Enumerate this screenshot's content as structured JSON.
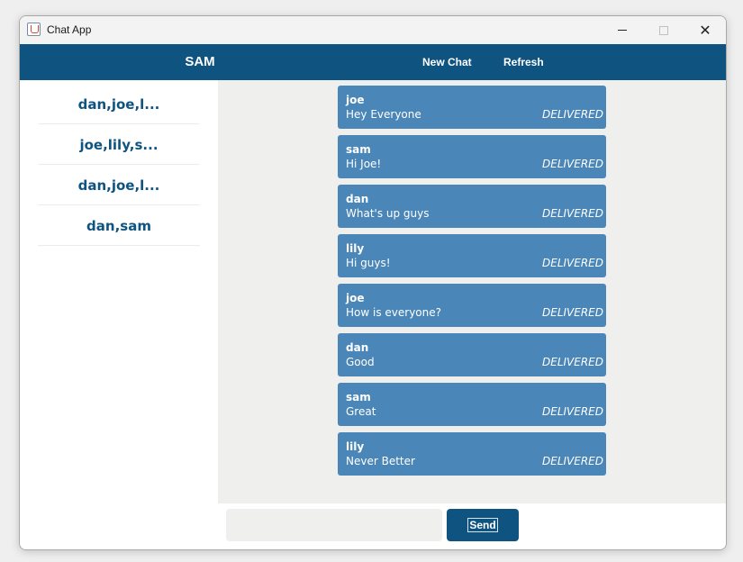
{
  "window": {
    "title": "Chat App",
    "icon": "java-cup-icon"
  },
  "header": {
    "user_name": "SAM",
    "new_chat_label": "New Chat",
    "refresh_label": "Refresh"
  },
  "sidebar": {
    "chats": [
      {
        "label": "dan,joe,l..."
      },
      {
        "label": "joe,lily,s..."
      },
      {
        "label": "dan,joe,l..."
      },
      {
        "label": "dan,sam"
      }
    ]
  },
  "messages": [
    {
      "sender": "joe",
      "text": "Hey Everyone",
      "status": "DELIVERED"
    },
    {
      "sender": "sam",
      "text": "Hi Joe!",
      "status": "DELIVERED"
    },
    {
      "sender": "dan",
      "text": "What's up guys",
      "status": "DELIVERED"
    },
    {
      "sender": "lily",
      "text": "Hi guys!",
      "status": "DELIVERED"
    },
    {
      "sender": "joe",
      "text": "How is everyone?",
      "status": "DELIVERED"
    },
    {
      "sender": "dan",
      "text": "Good",
      "status": "DELIVERED"
    },
    {
      "sender": "sam",
      "text": "Great",
      "status": "DELIVERED"
    },
    {
      "sender": "lily",
      "text": "Never Better",
      "status": "DELIVERED"
    }
  ],
  "composer": {
    "input_value": "",
    "send_label": "Send"
  },
  "colors": {
    "primary": "#0f5381",
    "bubble": "#4a86b7",
    "panel_bg": "#efefed"
  }
}
